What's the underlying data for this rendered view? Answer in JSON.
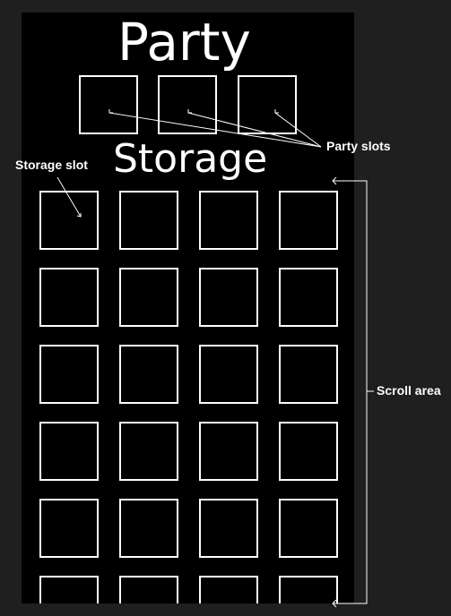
{
  "screen": {
    "title": "Party",
    "storage_title": "Storage"
  },
  "party": {
    "slot_count": 3
  },
  "storage": {
    "columns": 4,
    "visible_rows": 6,
    "slot_count": 24
  },
  "annotations": {
    "party_slots": "Party slots",
    "storage_slot": "Storage slot",
    "scroll_area": "Scroll area"
  },
  "colors": {
    "background": "#1f1f1f",
    "screen": "#000000",
    "foreground": "#ffffff"
  }
}
